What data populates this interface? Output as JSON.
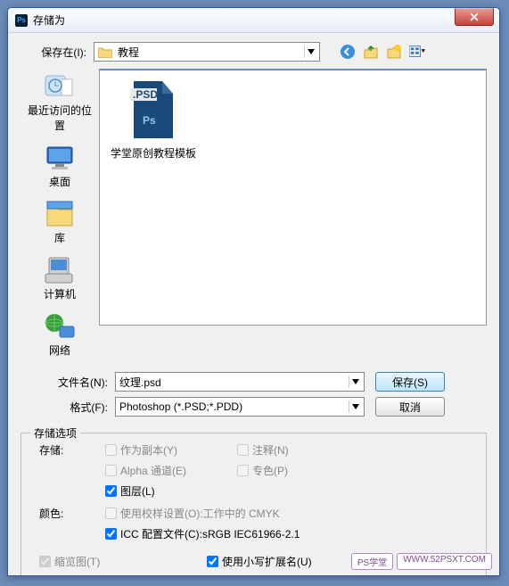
{
  "title": "存储为",
  "savein_label": "保存在(I):",
  "savein_value": "教程",
  "sidebar": [
    {
      "label": "最近访问的位置"
    },
    {
      "label": "桌面"
    },
    {
      "label": "库"
    },
    {
      "label": "计算机"
    },
    {
      "label": "网络"
    }
  ],
  "file": {
    "name": "学堂原创教程模板"
  },
  "filename_label": "文件名(N):",
  "filename_value": "纹理.psd",
  "format_label": "格式(F):",
  "format_value": "Photoshop (*.PSD;*.PDD)",
  "save_btn": "保存(S)",
  "cancel_btn": "取消",
  "options_legend": "存储选项",
  "group_save": "存储:",
  "group_color": "颜色:",
  "chk_copy": "作为副本(Y)",
  "chk_notes": "注释(N)",
  "chk_alpha": "Alpha 通道(E)",
  "chk_spot": "专色(P)",
  "chk_layers": "图层(L)",
  "chk_proof_a": "使用校样设置(O):",
  "chk_proof_b": " 工作中的 CMYK",
  "chk_icc_a": "ICC 配置文件(C):",
  "chk_icc_b": " sRGB IEC61966-2.1",
  "chk_thumb": "缩览图(T)",
  "chk_lower": "使用小写扩展名(U)",
  "wm1": "PS学堂",
  "wm2": "WWW.52PSXT.COM"
}
